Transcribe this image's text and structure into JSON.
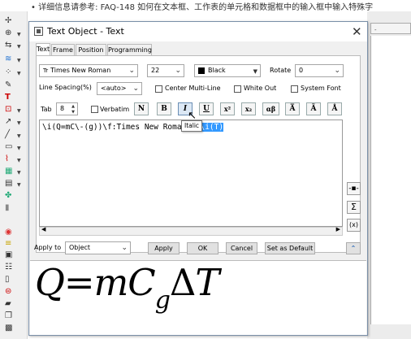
{
  "background": {
    "top_text": "• 详细信息请参考: FAQ-148 如何在文本框、工作表的单元格和数据框中的输入框中输入特殊字",
    "right_panel_label": "-"
  },
  "dialog": {
    "title": "Text Object - Text",
    "tabs": [
      "Text",
      "Frame",
      "Position",
      "Programming"
    ],
    "active_tab": "Text",
    "font": "Times New Roman",
    "font_icon": "Tr",
    "size": "22",
    "color_label": "Black",
    "color_hex": "#000000",
    "rotate_label": "Rotate",
    "rotate_value": "0",
    "line_spacing_label": "Line Spacing(%)",
    "line_spacing_value": "<auto>",
    "center_multiline_label": "Center Multi-Line",
    "white_out_label": "White Out",
    "system_font_label": "System Font",
    "tab_label": "Tab",
    "tab_value": "8",
    "verbatim_label": "Verbatim",
    "format_buttons": [
      "N",
      "B",
      "I",
      "U",
      "x²",
      "x₂",
      "αβ",
      "A̅",
      "Ã",
      "Å"
    ],
    "tooltip": "Italic",
    "text_content_before": "\\i(Q=mC\\-(g))\\f:Times New Roman(Δ)",
    "text_content_selected": "\\i(T)",
    "side_buttons": [
      "-▪-",
      "Σ",
      "(x)"
    ],
    "apply_to_label": "Apply to",
    "apply_to_value": "Object",
    "apply_label": "Apply",
    "ok_label": "OK",
    "cancel_label": "Cancel",
    "set_default_label": "Set as Default",
    "expand_label": "⌃",
    "preview": {
      "main": "Q=mC",
      "sub": "g",
      "delta": "Δ",
      "tail": "T"
    }
  }
}
